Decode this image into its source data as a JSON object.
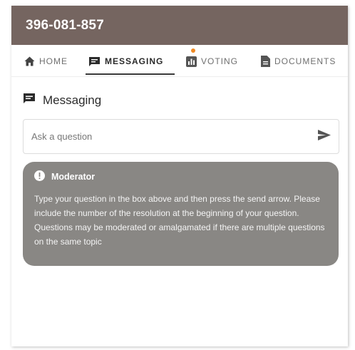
{
  "header": {
    "title": "396-081-857"
  },
  "tabs": [
    {
      "label": "HOME",
      "icon": "home-icon"
    },
    {
      "label": "MESSAGING",
      "icon": "message-icon"
    },
    {
      "label": "VOTING",
      "icon": "bar-chart-icon"
    },
    {
      "label": "DOCUMENTS",
      "icon": "document-icon"
    }
  ],
  "active_tab": "MESSAGING",
  "voting_badge_color": "#f08a24",
  "section": {
    "title": "Messaging",
    "icon": "message-icon"
  },
  "question_input": {
    "placeholder": "Ask a question",
    "value": ""
  },
  "moderator": {
    "title": "Moderator",
    "message": "Type your question in the box above and then press the send arrow. Please include the number of the resolution at the beginning of your question. Questions may be moderated or amalgamated if there are multiple questions on the same topic"
  },
  "colors": {
    "header_bg": "#756560",
    "moderator_bg": "#898784"
  }
}
